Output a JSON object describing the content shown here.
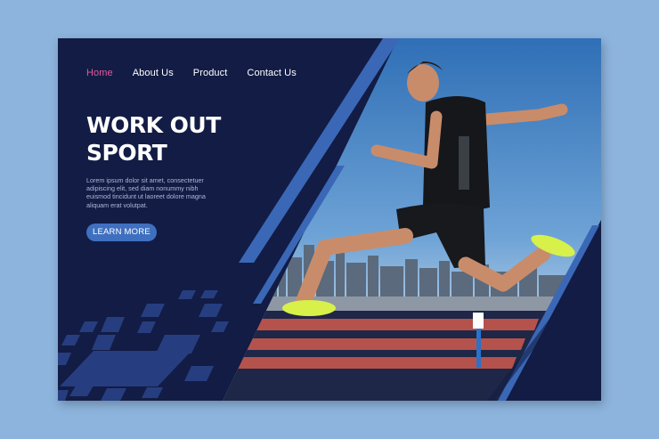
{
  "nav": {
    "items": [
      {
        "label": "Home",
        "active": true
      },
      {
        "label": "About Us",
        "active": false
      },
      {
        "label": "Product",
        "active": false
      },
      {
        "label": "Contact Us",
        "active": false
      }
    ]
  },
  "hero": {
    "title_line1": "WORK OUT",
    "title_line2": "SPORT",
    "body": "Lorem ipsum dolor sit amet, consectetuer adipiscing elit, sed diam nonummy nibh euismod tincidunt ut laoreet dolore magna aliquam erat volutpat.",
    "cta_label": "LEARN MORE"
  },
  "colors": {
    "page_background": "#8db4dd",
    "card_background": "#121c45",
    "accent_pink": "#e8579a",
    "accent_blue": "#3f70c0",
    "track_red": "#b5524c",
    "shoe_yellow": "#d7f04a"
  }
}
